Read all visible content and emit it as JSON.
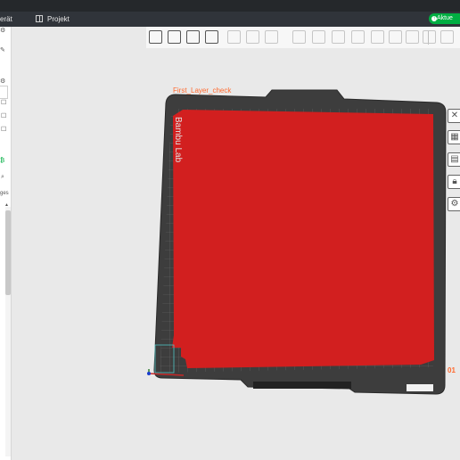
{
  "menubar": {
    "device_tab": "erät",
    "project_tab": "Projekt",
    "update_button": "Aktue"
  },
  "sidebar": {
    "tab_label": "ges",
    "teal_label": "₿"
  },
  "viewport": {
    "plate_name": "First_Layer_check",
    "plate_number": "01",
    "bed_brand": "Bambu Lab"
  },
  "colors": {
    "accent_green": "#00ae42",
    "plate_label": "#ff6a2f",
    "model_red": "#d21f1f",
    "bed_dark": "#3d3d3d"
  }
}
